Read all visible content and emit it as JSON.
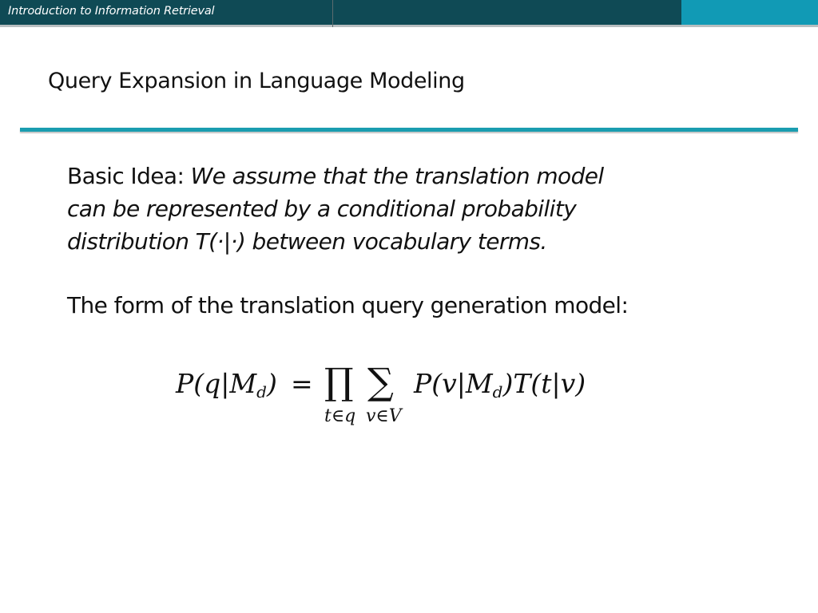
{
  "header": {
    "course_title": "Introduction to Information Retrieval",
    "bar_color": "#0f4a55",
    "accent_color": "#119ab5"
  },
  "slide": {
    "title": "Query Expansion in Language Modeling",
    "rule_color": "#1a9db0",
    "basic_idea": {
      "label": "Basic Idea: ",
      "lines": [
        "We assume that the translation model",
        "can be represented by a conditional probability",
        "distribution T(·|·) between vocabulary terms."
      ]
    },
    "form_statement": "The form of the translation query generation model:",
    "formula": {
      "lhs": "P(q|M",
      "lhs_sub": "d",
      "lhs_close": ")",
      "equals": "=",
      "product_symbol": "∏",
      "product_limit": "t∈q",
      "sum_symbol": "∑",
      "sum_limit": "v∈V",
      "rhs_a": "P(v|M",
      "rhs_sub": "d",
      "rhs_b": ")T(t|v)"
    }
  }
}
